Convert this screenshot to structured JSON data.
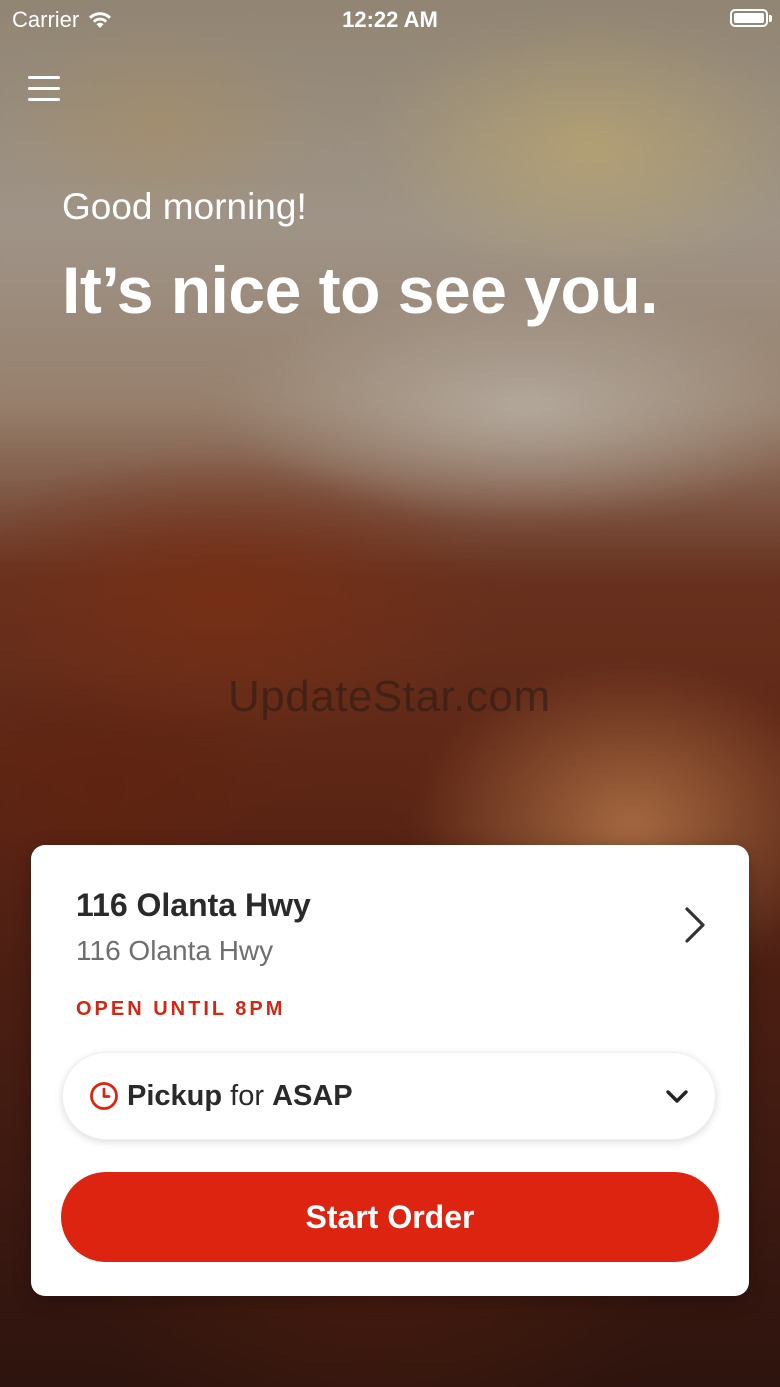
{
  "status_bar": {
    "carrier": "Carrier",
    "time": "12:22 AM",
    "icons": [
      "wifi-icon",
      "battery-icon"
    ]
  },
  "header": {
    "menu_icon": "hamburger-menu-icon",
    "greeting": "Good morning!",
    "headline": "It’s nice to see you."
  },
  "watermark": "UpdateStar.com",
  "store": {
    "name": "116 Olanta Hwy",
    "address": "116 Olanta Hwy",
    "hours": "OPEN UNTIL 8PM",
    "chevron_icon": "chevron-right-icon"
  },
  "order_type": {
    "icon": "clock-icon",
    "mode": "Pickup",
    "connector": "for",
    "time": "ASAP",
    "chevron_icon": "chevron-down-icon"
  },
  "actions": {
    "start_order_label": "Start Order"
  },
  "colors": {
    "accent": "#dc2410",
    "hours_text": "#d22813",
    "card_bg": "#ffffff",
    "primary_text": "#2a2a2a",
    "secondary_text": "#6e6e6e"
  }
}
